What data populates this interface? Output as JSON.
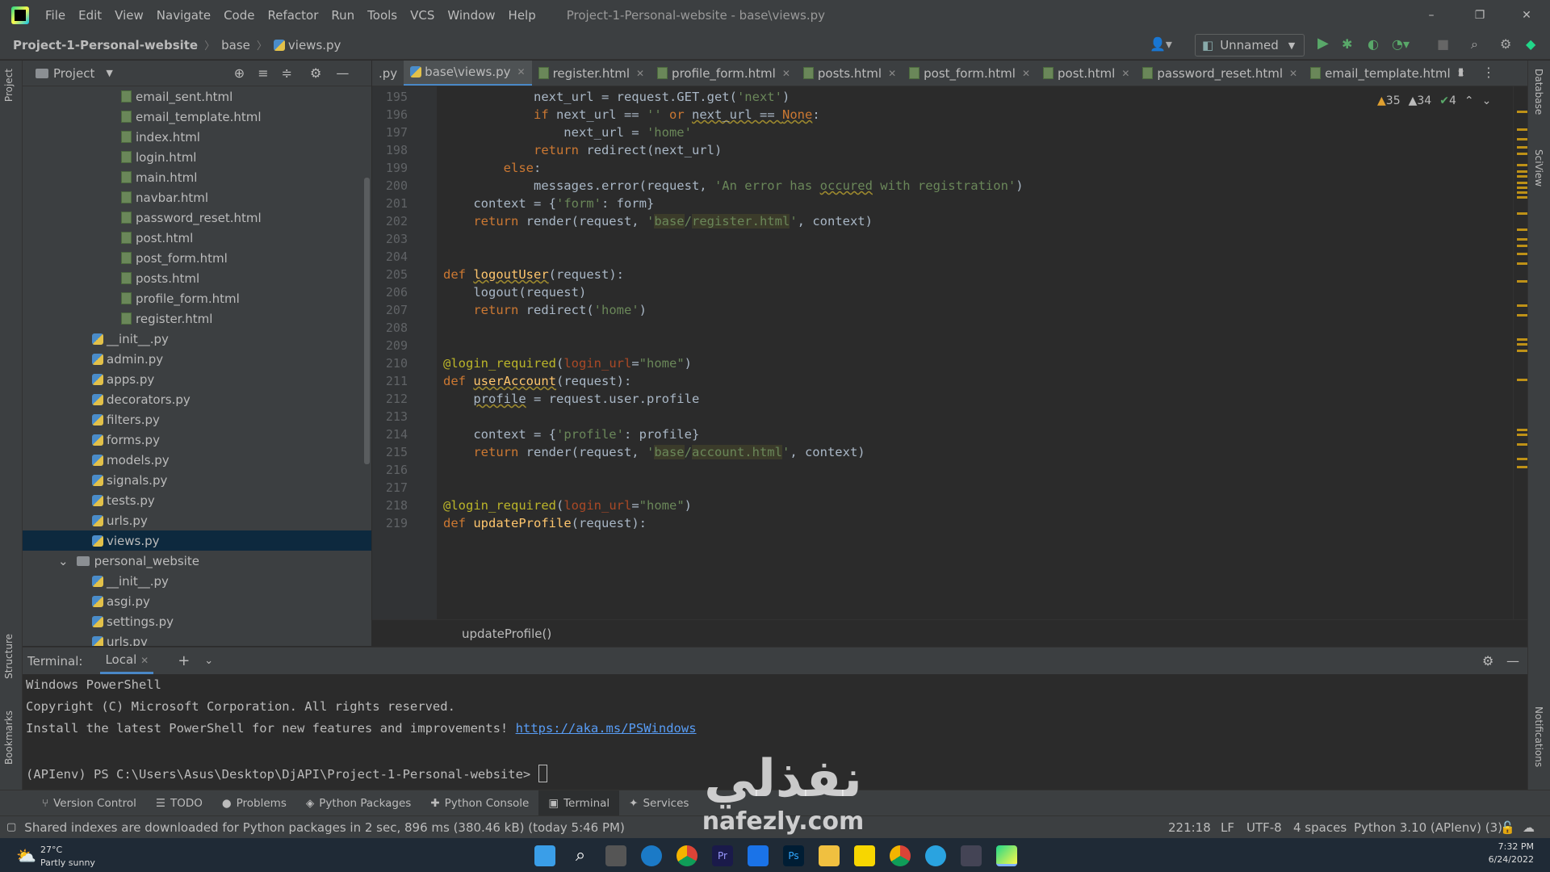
{
  "menu": [
    "File",
    "Edit",
    "View",
    "Navigate",
    "Code",
    "Refactor",
    "Run",
    "Tools",
    "VCS",
    "Window",
    "Help"
  ],
  "window_title": "Project-1-Personal-website - base\\views.py",
  "window_controls": {
    "minimize": "–",
    "maximize": "❐",
    "close": "✕"
  },
  "breadcrumb": {
    "project": "Project-1-Personal-website",
    "folder": "base",
    "file": "views.py"
  },
  "run_config": "Unnamed",
  "project_panel": {
    "title": "Project"
  },
  "tree": [
    {
      "label": "email_sent.html",
      "type": "html",
      "indent": 3
    },
    {
      "label": "email_template.html",
      "type": "html",
      "indent": 3
    },
    {
      "label": "index.html",
      "type": "html",
      "indent": 3
    },
    {
      "label": "login.html",
      "type": "html",
      "indent": 3
    },
    {
      "label": "main.html",
      "type": "html",
      "indent": 3
    },
    {
      "label": "navbar.html",
      "type": "html",
      "indent": 3
    },
    {
      "label": "password_reset.html",
      "type": "html",
      "indent": 3
    },
    {
      "label": "post.html",
      "type": "html",
      "indent": 3
    },
    {
      "label": "post_form.html",
      "type": "html",
      "indent": 3
    },
    {
      "label": "posts.html",
      "type": "html",
      "indent": 3
    },
    {
      "label": "profile_form.html",
      "type": "html",
      "indent": 3
    },
    {
      "label": "register.html",
      "type": "html",
      "indent": 3
    },
    {
      "label": "__init__.py",
      "type": "py",
      "indent": 2
    },
    {
      "label": "admin.py",
      "type": "py",
      "indent": 2
    },
    {
      "label": "apps.py",
      "type": "py",
      "indent": 2
    },
    {
      "label": "decorators.py",
      "type": "py",
      "indent": 2
    },
    {
      "label": "filters.py",
      "type": "py",
      "indent": 2
    },
    {
      "label": "forms.py",
      "type": "py",
      "indent": 2
    },
    {
      "label": "models.py",
      "type": "py",
      "indent": 2
    },
    {
      "label": "signals.py",
      "type": "py",
      "indent": 2
    },
    {
      "label": "tests.py",
      "type": "py",
      "indent": 2
    },
    {
      "label": "urls.py",
      "type": "py",
      "indent": 2
    },
    {
      "label": "views.py",
      "type": "py",
      "indent": 2,
      "selected": true
    },
    {
      "label": "personal_website",
      "type": "folder",
      "indent": 1
    },
    {
      "label": "__init__.py",
      "type": "py",
      "indent": 2
    },
    {
      "label": "asgi.py",
      "type": "py",
      "indent": 2
    },
    {
      "label": "settings.py",
      "type": "py",
      "indent": 2
    },
    {
      "label": "urls.py",
      "type": "py",
      "indent": 2
    }
  ],
  "tabs": [
    {
      "label": ".py",
      "type": "none"
    },
    {
      "label": "base\\views.py",
      "type": "py",
      "active": true
    },
    {
      "label": "register.html",
      "type": "html"
    },
    {
      "label": "profile_form.html",
      "type": "html"
    },
    {
      "label": "posts.html",
      "type": "html"
    },
    {
      "label": "post_form.html",
      "type": "html"
    },
    {
      "label": "post.html",
      "type": "html"
    },
    {
      "label": "password_reset.html",
      "type": "html"
    },
    {
      "label": "email_template.html",
      "type": "html"
    }
  ],
  "inspections": {
    "warnings": "35",
    "weak_warnings": "34",
    "ok": "4"
  },
  "code_lines": [
    {
      "n": "195",
      "html": "            next_url = request.GET.get(<span class='str'>'next'</span>)"
    },
    {
      "n": "196",
      "html": "            <span class='kw'>if</span> next_url == <span class='str'>''</span> <span class='kw'>or</span> <span class='under'>next_url == </span><span class='kw under'>None</span>:"
    },
    {
      "n": "197",
      "html": "                next_url = <span class='str'>'home'</span>"
    },
    {
      "n": "198",
      "html": "            <span class='kw'>return</span> redirect(next_url)"
    },
    {
      "n": "199",
      "html": "        <span class='kw'>else</span>:"
    },
    {
      "n": "200",
      "html": "            messages.error(request, <span class='str'>'An error has <span class=\"under\">occured</span> with registration'</span>)"
    },
    {
      "n": "201",
      "html": "    context = {<span class='str'>'form'</span>: form}"
    },
    {
      "n": "202",
      "html": "    <span class='kw'>return</span> render(request, <span class='str'>'<span class=\"hl\">base</span>/<span class=\"hl\">register.html</span>'</span>, context)"
    },
    {
      "n": "203",
      "html": ""
    },
    {
      "n": "204",
      "html": ""
    },
    {
      "n": "205",
      "html": "<span class='kw'>def</span> <span class='fn under'>logoutUser</span>(request):"
    },
    {
      "n": "206",
      "html": "    logout(request)"
    },
    {
      "n": "207",
      "html": "    <span class='kw'>return</span> redirect(<span class='str'>'home'</span>)"
    },
    {
      "n": "208",
      "html": ""
    },
    {
      "n": "209",
      "html": ""
    },
    {
      "n": "210",
      "html": "<span class='deco'>@login_required</span>(<span class='param'>login_url</span>=<span class='str'>\"home\"</span>)"
    },
    {
      "n": "211",
      "html": "<span class='kw'>def</span> <span class='fn under'>userAccount</span>(request):"
    },
    {
      "n": "212",
      "html": "    <span class='under'>profile</span> = request.user.profile"
    },
    {
      "n": "213",
      "html": ""
    },
    {
      "n": "214",
      "html": "    context = {<span class='str'>'profile'</span>: profile}"
    },
    {
      "n": "215",
      "html": "    <span class='kw'>return</span> render(request, <span class='str'>'<span class=\"hl\">base</span>/<span class=\"hl\">account.html</span>'</span>, context)"
    },
    {
      "n": "216",
      "html": ""
    },
    {
      "n": "217",
      "html": ""
    },
    {
      "n": "218",
      "html": "<span class='deco'>@login_required</span>(<span class='param'>login_url</span>=<span class='str'>\"home\"</span>)"
    },
    {
      "n": "219",
      "html": "<span class='kw'>def</span> <span class='fn'>updateProfile</span>(request):"
    }
  ],
  "editor_breadcrumb": "updateProfile()",
  "terminal": {
    "label": "Terminal:",
    "tab": "Local",
    "lines": [
      "Windows PowerShell",
      "Copyright (C) Microsoft Corporation. All rights reserved."
    ],
    "install_prefix": "Install the latest PowerShell for new features and improvements! ",
    "install_link": "https://aka.ms/PSWindows",
    "prompt": "(APIenv) PS C:\\Users\\Asus\\Desktop\\DjAPI\\Project-1-Personal-website> "
  },
  "toolwindows": [
    "Version Control",
    "TODO",
    "Problems",
    "Python Packages",
    "Python Console",
    "Terminal",
    "Services"
  ],
  "status": {
    "message": "Shared indexes are downloaded for Python packages in 2 sec, 896 ms (380.46 kB) (today 5:46 PM)",
    "position": "221:18",
    "line_sep": "LF",
    "encoding": "UTF-8",
    "indent": "4 spaces",
    "interpreter": "Python 3.10 (APIenv) (3)"
  },
  "side_tabs": {
    "project": "Project",
    "structure": "Structure",
    "bookmarks": "Bookmarks",
    "database": "Database",
    "sciview": "SciView",
    "notifications": "Notifications"
  },
  "taskbar": {
    "weather_temp": "27°C",
    "weather_desc": "Partly sunny",
    "time": "7:32 PM",
    "date": "6/24/2022"
  },
  "watermark": {
    "arabic": "نفذلي",
    "latin": "nafezly.com"
  }
}
